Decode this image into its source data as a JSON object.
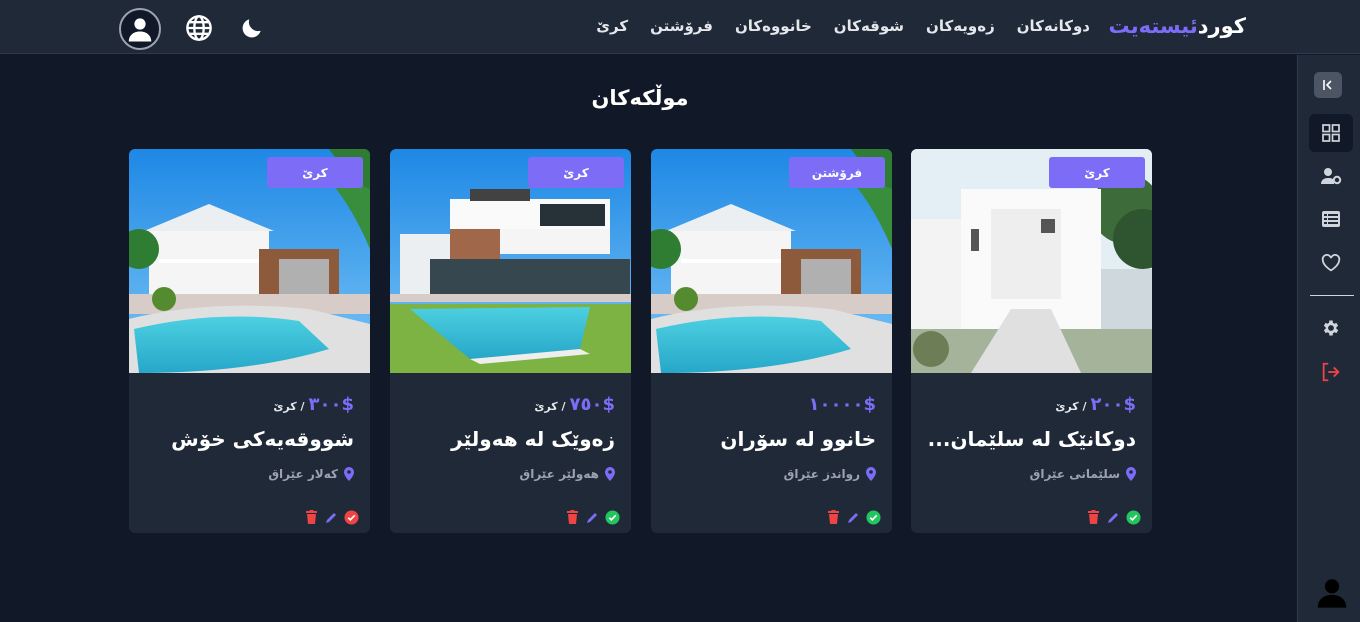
{
  "header": {
    "brand_part1": "كورد",
    "brand_part2": "ئیستەیت",
    "nav": [
      "کرێ",
      "فرۆشتن",
      "خانووەکان",
      "شوقەکان",
      "زەویەکان",
      "دوکانەکان"
    ]
  },
  "page": {
    "title": "موڵکەکان"
  },
  "colors": {
    "accent": "#7c6cf6",
    "bg": "#111827",
    "panel": "#1f2937",
    "success": "#22c55e",
    "danger": "#ef4444"
  },
  "cards": [
    {
      "badge": "کرێ",
      "price": "$٢٠٠",
      "per": "/ کرێ",
      "title": "دوکانێک لە سلێمان...",
      "location": "سلێمانی عێراق",
      "status": "approved"
    },
    {
      "badge": "فرۆشتن",
      "price": "$١٠٠٠٠",
      "per": "",
      "title": "خانوو لە سۆران",
      "location": "رواندز عێراق",
      "status": "approved"
    },
    {
      "badge": "کرێ",
      "price": "$٧٥٠",
      "per": "/ کرێ",
      "title": "زەوێک لە هەولێر",
      "location": "هەولێر عێراق",
      "status": "approved"
    },
    {
      "badge": "کرێ",
      "price": "$٣٠٠",
      "per": "/ کرێ",
      "title": "شووقەیەکی خۆش",
      "location": "کەلار عێراق",
      "status": "rejected"
    }
  ],
  "icons": {
    "theme": "moon-icon",
    "language": "globe-icon",
    "profile": "user-icon",
    "sidebar": [
      "collapse-icon",
      "dashboard-icon",
      "user-settings-icon",
      "list-icon",
      "heart-icon",
      "settings-icon",
      "logout-icon"
    ]
  }
}
